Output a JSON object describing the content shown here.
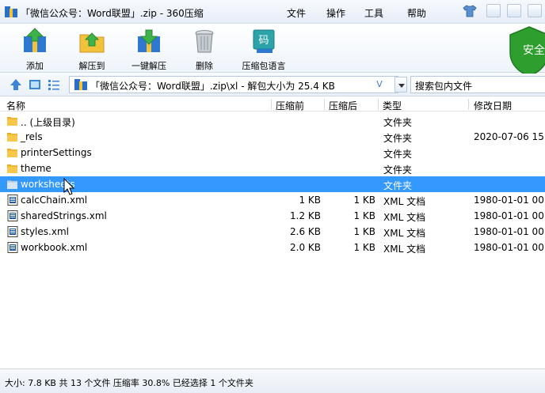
{
  "window": {
    "title": "「微信公众号：Word联盟」.zip - 360压缩",
    "menu": [
      "文件",
      "操作",
      "工具",
      "帮助"
    ]
  },
  "toolbar": {
    "buttons": [
      {
        "label": "添加",
        "icon": "add-icon"
      },
      {
        "label": "解压到",
        "icon": "extract-to-icon"
      },
      {
        "label": "一键解压",
        "icon": "one-click-extract-icon"
      },
      {
        "label": "删除",
        "icon": "delete-icon"
      },
      {
        "label": "压缩包语言",
        "icon": "archive-language-icon"
      }
    ],
    "language_badge": "码",
    "security": "安全"
  },
  "address": {
    "path": "「微信公众号：Word联盟」.zip\\xl - 解包大小为 25.4 KB",
    "dropdown_label": "V",
    "search_placeholder": "搜索包内文件"
  },
  "columns": [
    "名称",
    "压缩前",
    "压缩后",
    "类型",
    "修改日期"
  ],
  "rows": [
    {
      "name": ".. (上级目录)",
      "before": "",
      "after": "",
      "type": "文件夹",
      "date": "",
      "icon": "parent-folder-icon"
    },
    {
      "name": "_rels",
      "before": "",
      "after": "",
      "type": "文件夹",
      "date": "2020-07-06 15",
      "icon": "folder-icon"
    },
    {
      "name": "printerSettings",
      "before": "",
      "after": "",
      "type": "文件夹",
      "date": "",
      "icon": "folder-icon"
    },
    {
      "name": "theme",
      "before": "",
      "after": "",
      "type": "文件夹",
      "date": "",
      "icon": "folder-icon"
    },
    {
      "name": "worksheets",
      "before": "",
      "after": "",
      "type": "文件夹",
      "date": "",
      "icon": "folder-icon",
      "selected": true
    },
    {
      "name": "calcChain.xml",
      "before": "1 KB",
      "after": "1 KB",
      "type": "XML 文档",
      "date": "1980-01-01 00",
      "icon": "xml-file-icon"
    },
    {
      "name": "sharedStrings.xml",
      "before": "1.2 KB",
      "after": "1 KB",
      "type": "XML 文档",
      "date": "1980-01-01 00",
      "icon": "xml-file-icon"
    },
    {
      "name": "styles.xml",
      "before": "2.6 KB",
      "after": "1 KB",
      "type": "XML 文档",
      "date": "1980-01-01 00",
      "icon": "xml-file-icon"
    },
    {
      "name": "workbook.xml",
      "before": "2.0 KB",
      "after": "1 KB",
      "type": "XML 文档",
      "date": "1980-01-01 00",
      "icon": "xml-file-icon"
    }
  ],
  "status": "大小: 7.8 KB 共 13 个文件 压缩率 30.8% 已经选择 1 个文件夹",
  "colors": {
    "selection": "#3399ff",
    "folder": "#f2b632",
    "accent": "#1f7bd1",
    "shield": "#2e9e2e"
  }
}
